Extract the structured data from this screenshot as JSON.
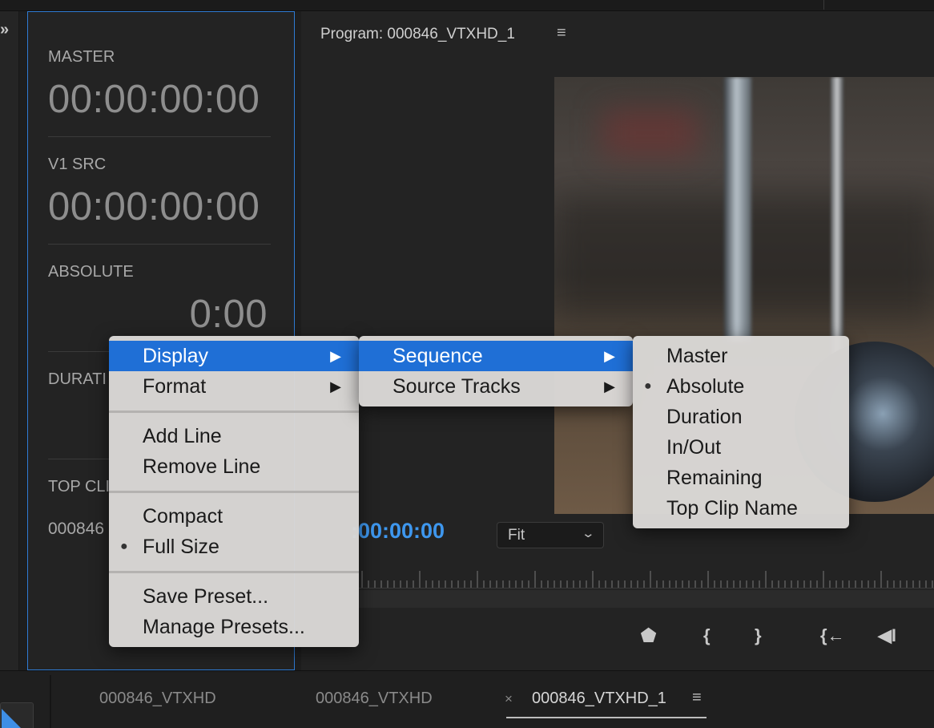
{
  "timecode_panel": {
    "master_label": "MASTER",
    "master_value": "00:00:00:00",
    "v1src_label": "V1 SRC",
    "v1src_value": "00:00:00:00",
    "absolute_label": "ABSOLUTE",
    "absolute_value": "0:00",
    "duration_label": "DURATI",
    "topclip_label": "TOP CLI",
    "clip_value": "000846"
  },
  "left_strip": {
    "expand_icon": "»"
  },
  "monitor": {
    "title": "Program: 000846_VTXHD_1",
    "menu_icon": "≡",
    "playhead_timecode": ":00:00:00",
    "fit_value": "Fit",
    "fit_chevron": "⌄"
  },
  "controls": {
    "marker_icon": "⬟",
    "mark_in_icon": "{",
    "mark_out_icon": "}",
    "go_to_in_icon": "{←",
    "step_back_icon": "◀I"
  },
  "tabs": [
    {
      "label": "000846_VTXHD"
    },
    {
      "label": "000846_VTXHD"
    },
    {
      "label": "000846_VTXHD_1",
      "active": true
    }
  ],
  "tab_close": "×",
  "tab_menu": "≡",
  "menu1": {
    "items": [
      {
        "label": "Display",
        "submenu": true,
        "highlighted": true
      },
      {
        "label": "Format",
        "submenu": true
      },
      {
        "label": "Add Line"
      },
      {
        "label": "Remove Line"
      },
      {
        "label": "Compact"
      },
      {
        "label": "Full Size",
        "checked": true
      },
      {
        "label": "Save Preset..."
      },
      {
        "label": "Manage Presets..."
      }
    ]
  },
  "menu2": {
    "items": [
      {
        "label": "Sequence",
        "submenu": true,
        "highlighted": true
      },
      {
        "label": "Source Tracks",
        "submenu": true
      }
    ]
  },
  "menu3": {
    "items": [
      {
        "label": "Master"
      },
      {
        "label": "Absolute",
        "checked": true
      },
      {
        "label": "Duration"
      },
      {
        "label": "In/Out"
      },
      {
        "label": "Remaining"
      },
      {
        "label": "Top Clip Name"
      }
    ]
  },
  "glyphs": {
    "submenu_arrow": "▶",
    "bullet": "●"
  },
  "colors": {
    "accent_blue": "#1f6fd6",
    "timecode_blue": "#3e97ee",
    "panel_border": "#2f7bd4"
  }
}
